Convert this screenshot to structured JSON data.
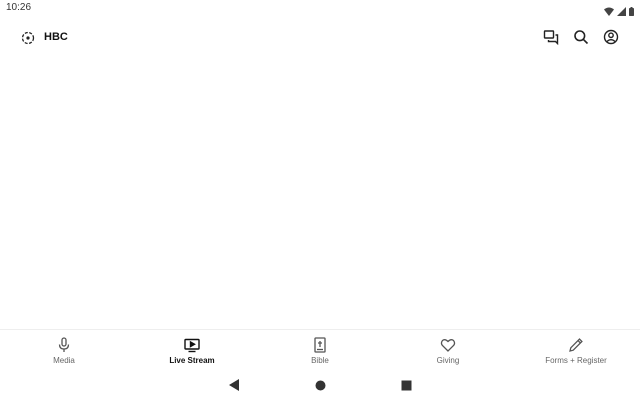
{
  "status_bar": {
    "time": "10:26",
    "icons": [
      "wifi-icon",
      "signal-icon",
      "battery-icon"
    ]
  },
  "app_bar": {
    "logo_icon": "church-logo-icon",
    "title": "HBC",
    "actions": [
      "chat-icon",
      "search-icon",
      "account-icon"
    ]
  },
  "bottom_nav": {
    "items": [
      {
        "label": "Media",
        "icon": "microphone-icon",
        "active": false
      },
      {
        "label": "Live Stream",
        "icon": "live-tv-icon",
        "active": true
      },
      {
        "label": "Bible",
        "icon": "bible-icon",
        "active": false
      },
      {
        "label": "Giving",
        "icon": "heart-icon",
        "active": false
      },
      {
        "label": "Forms + Register",
        "icon": "pencil-icon",
        "active": false
      }
    ]
  },
  "system_nav": {
    "buttons": [
      "back-icon",
      "home-icon",
      "recents-icon"
    ]
  },
  "colors": {
    "background": "#ffffff",
    "text_primary": "#111111",
    "text_secondary": "#666666",
    "divider": "#eeeeee"
  }
}
